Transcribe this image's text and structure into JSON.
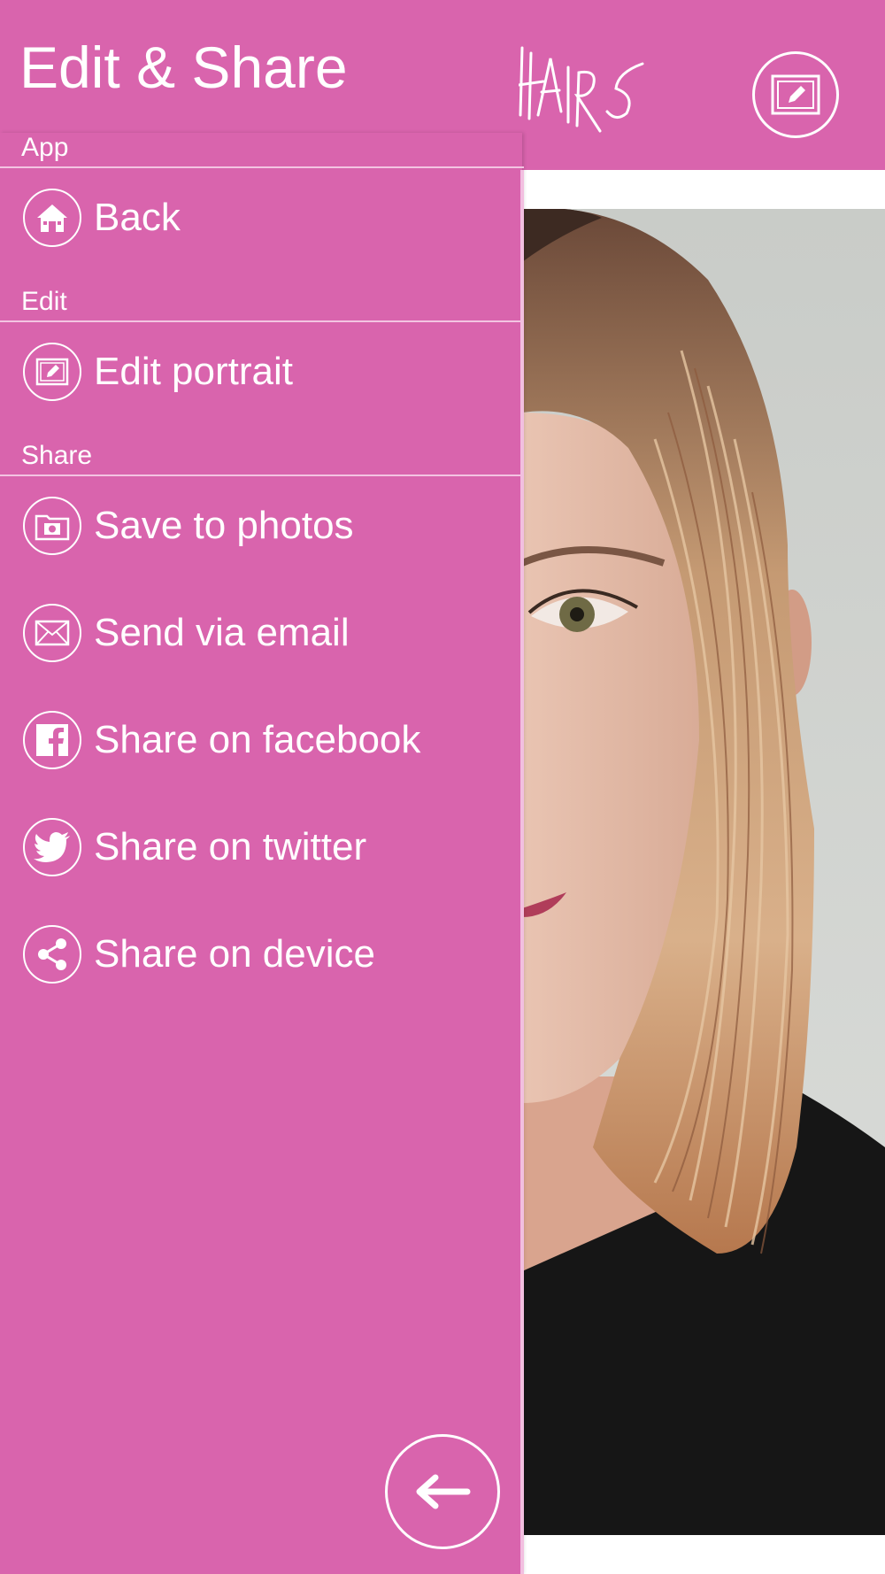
{
  "header": {
    "title": "Edit & Share",
    "logo_text": "HAIRS",
    "edit_icon": "pencil-frame-icon"
  },
  "menu": {
    "sections": [
      {
        "label": "App",
        "items": [
          {
            "label": "Back",
            "icon": "house-icon"
          }
        ]
      },
      {
        "label": "Edit",
        "items": [
          {
            "label": "Edit portrait",
            "icon": "pencil-frame-icon"
          }
        ]
      },
      {
        "label": "Share",
        "items": [
          {
            "label": "Save to photos",
            "icon": "camera-folder-icon"
          },
          {
            "label": "Send via email",
            "icon": "envelope-icon"
          },
          {
            "label": "Share on facebook",
            "icon": "facebook-icon"
          },
          {
            "label": "Share on twitter",
            "icon": "twitter-icon"
          },
          {
            "label": "Share on device",
            "icon": "share-nodes-icon"
          }
        ]
      }
    ]
  },
  "footer": {
    "back_icon": "arrow-left-icon"
  },
  "colors": {
    "accent": "#d964ad",
    "divider": "#f3c4e2",
    "text": "#ffffff"
  }
}
